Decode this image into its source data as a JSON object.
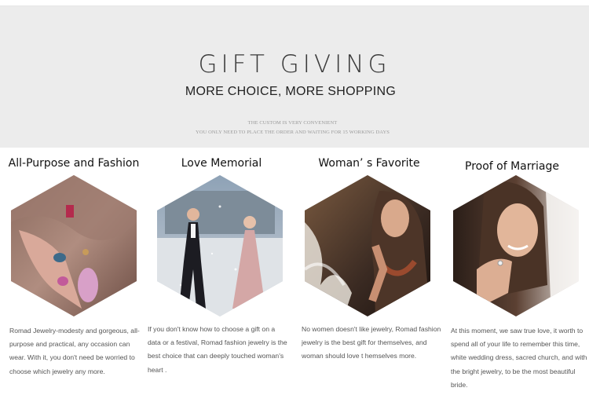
{
  "banner": {
    "title": "GIFT GIVING",
    "subtitle": "MORE CHOICE, MORE SHOPPING",
    "note_line1": "THE CUSTOM IS VERY CONVENIENT",
    "note_line2": "YOU ONLY NEED TO PLACE THE ORDER AND WAITING FOR 15 WORKING DAYS"
  },
  "features": [
    {
      "heading": "All-Purpose and Fashion",
      "image": "hand-with-rings-and-pendant-photo",
      "description": "Romad Jewelry-modesty and gorgeous, all-purpose and practical, any occasion can wear. With it, you don't need be worried to choose which jewelry any more."
    },
    {
      "heading": "Love Memorial",
      "image": "couple-walking-in-snow-photo",
      "description": "If you don't know how to choose a gift on a data or a festival, Romad fashion jewelry is the best choice that can deeply touched woman's heart ."
    },
    {
      "heading": "Woman’ s Favorite",
      "image": "laughing-woman-with-necklace-photo",
      "description": "No women doesn't like jewelry,  Romad fashion jewelry is the best gift  for themselves, and woman should love t hemselves more."
    },
    {
      "heading": "Proof of Marriage",
      "image": "bride-showing-ring-photo",
      "description": "At this moment, we saw true love, it worth to spend all of your life to remember this time, white wedding dress, sacred church, and with the bright jewelry, to be the most beautiful bride."
    }
  ]
}
